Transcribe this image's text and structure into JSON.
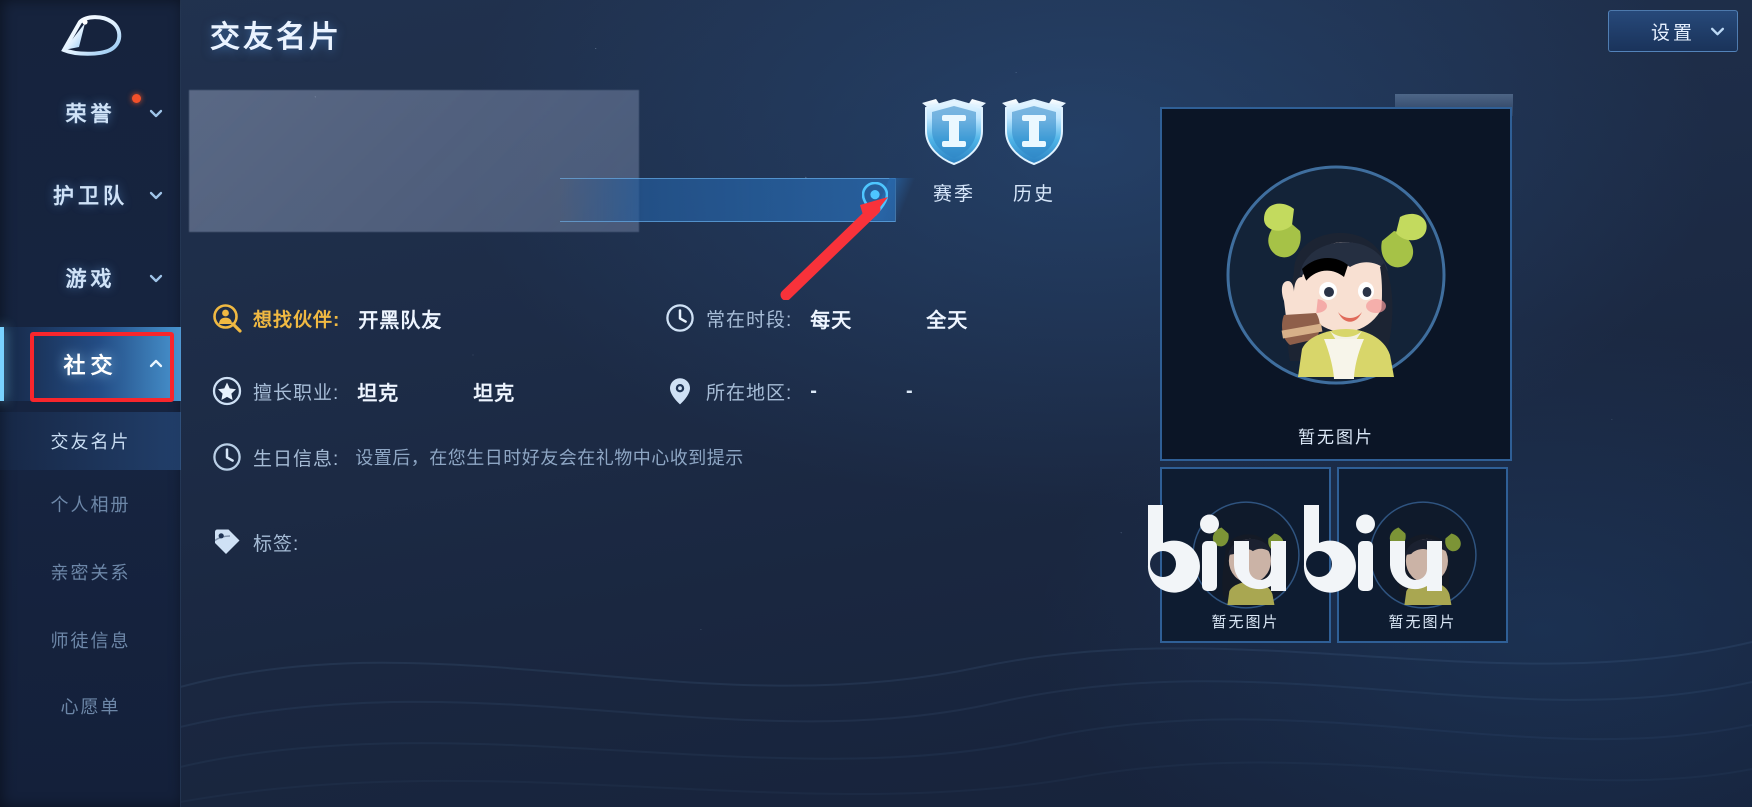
{
  "app": {
    "background_accent": "#1d2c47",
    "highlight_color": "#79d2ff",
    "annotation_color": "#f8262c"
  },
  "header": {
    "title": "交友名片",
    "settings_label": "设置",
    "settings_icon": "chevron-down-icon"
  },
  "sidebar": {
    "logo_icon": "game-logo-icon",
    "groups": [
      {
        "label": "荣誉",
        "icon": "chevron-down-icon",
        "has_badge": true
      },
      {
        "label": "护卫队",
        "icon": "chevron-down-icon",
        "has_badge": false
      },
      {
        "label": "游戏",
        "icon": "chevron-down-icon",
        "has_badge": false
      }
    ],
    "active_group": {
      "label": "社交",
      "icon": "chevron-up-icon"
    },
    "sub_items": [
      {
        "label": "交友名片",
        "selected": true
      },
      {
        "label": "个人相册",
        "selected": false
      },
      {
        "label": "亲密关系",
        "selected": false
      },
      {
        "label": "师徒信息",
        "selected": false
      },
      {
        "label": "心愿单",
        "selected": false
      }
    ]
  },
  "profile": {
    "masked_avatar_region": "",
    "search_bar_value": "",
    "search_bar_icon": "location-pin-icon",
    "badges": [
      {
        "label": "赛季",
        "icon": "rank-shield-icon"
      },
      {
        "label": "历史",
        "icon": "rank-shield-icon"
      }
    ],
    "rows": [
      {
        "icon": "person-search-icon",
        "label": "想找伙伴:",
        "label_style": "gold",
        "values": [
          "开黑队友"
        ]
      },
      {
        "icon": "star-circle-icon",
        "label": "擅长职业:",
        "label_style": "grey",
        "values": [
          "坦克",
          "坦克"
        ]
      },
      {
        "icon": "clock-icon",
        "label": "常在时段:",
        "label_style": "grey",
        "values": [
          "每天",
          "全天"
        ]
      },
      {
        "icon": "location-pin-icon",
        "label": "所在地区:",
        "label_style": "grey",
        "values": [
          "-",
          "-"
        ]
      },
      {
        "icon": "clock-icon",
        "label": "生日信息:",
        "label_style": "grey",
        "hint": "设置后，在您生日时好友会在礼物中心收到提示"
      },
      {
        "icon": "tag-icon",
        "label": "标签:",
        "label_style": "grey",
        "values": []
      }
    ]
  },
  "gallery": {
    "main_photo_caption": "暂无图片",
    "thumbnails": [
      {
        "caption": "暂无图片"
      },
      {
        "caption": "暂无图片"
      }
    ]
  },
  "watermark": {
    "text": "biubiu"
  },
  "annotation": {
    "arrow": "red-arrow-pointing-to-location-pin",
    "box": "red-box-around-social-nav-item"
  }
}
